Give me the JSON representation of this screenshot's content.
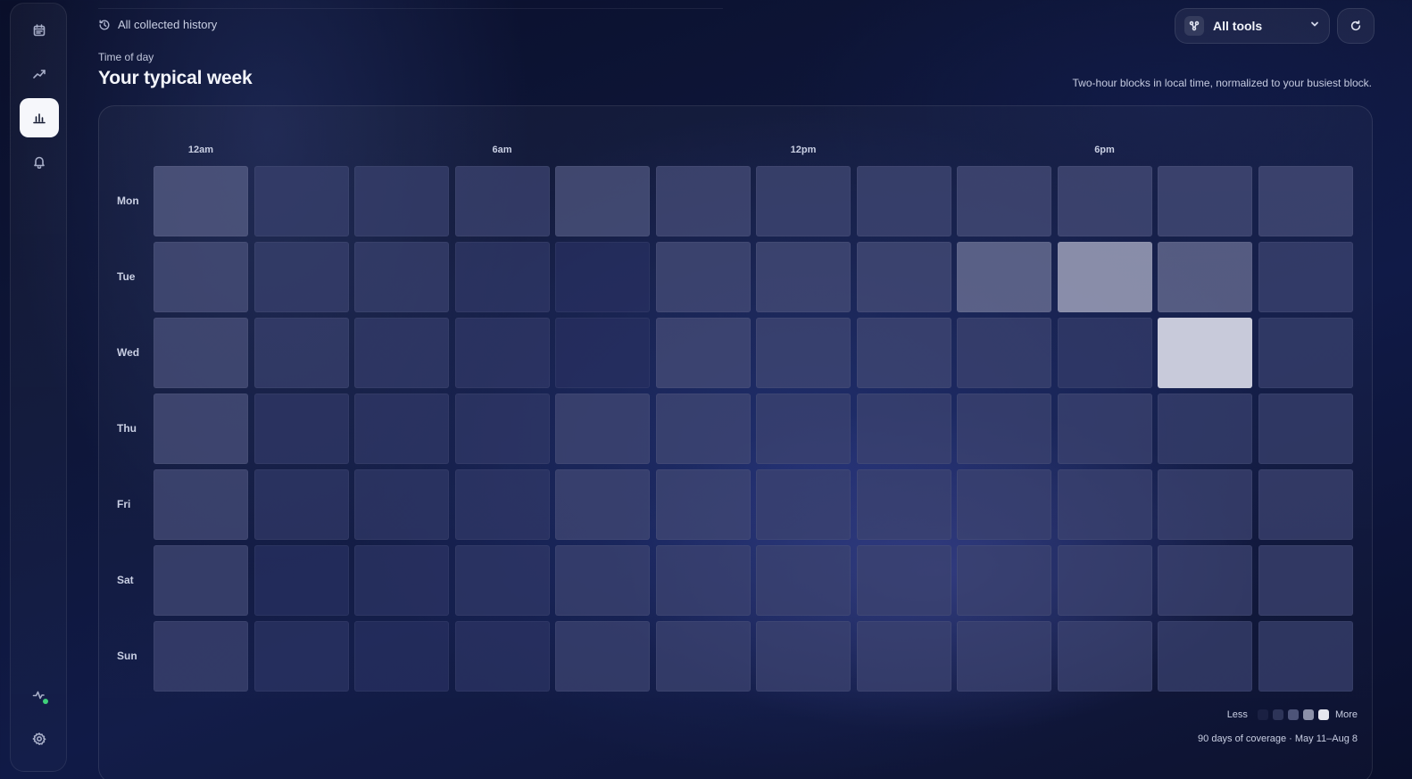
{
  "sidebar": {
    "items": [
      {
        "name": "calendar-icon",
        "active": false
      },
      {
        "name": "trend-icon",
        "active": false
      },
      {
        "name": "bar-chart-icon",
        "active": true
      },
      {
        "name": "bell-icon",
        "active": false
      }
    ],
    "bottom": [
      {
        "name": "activity-icon",
        "status": "online"
      },
      {
        "name": "gear-icon"
      }
    ]
  },
  "header": {
    "history_label": "All collected history",
    "eyebrow": "Time of day",
    "title": "Your typical week",
    "caption": "Two-hour blocks in local time, normalized to your busiest block.",
    "tools_label": "All tools"
  },
  "heatmap": {
    "hour_labels": [
      "12am",
      "6am",
      "12pm",
      "6pm"
    ],
    "days": [
      "Mon",
      "Tue",
      "Wed",
      "Thu",
      "Fri",
      "Sat",
      "Sun"
    ],
    "blocks_per_day": 12,
    "intensity": [
      [
        0.28,
        0.14,
        0.14,
        0.16,
        0.24,
        0.2,
        0.18,
        0.18,
        0.2,
        0.2,
        0.2,
        0.2
      ],
      [
        0.22,
        0.14,
        0.14,
        0.1,
        0.06,
        0.2,
        0.2,
        0.2,
        0.38,
        0.62,
        0.36,
        0.16
      ],
      [
        0.22,
        0.14,
        0.12,
        0.1,
        0.06,
        0.2,
        0.18,
        0.18,
        0.16,
        0.12,
        0.9,
        0.14
      ],
      [
        0.22,
        0.1,
        0.1,
        0.1,
        0.18,
        0.18,
        0.16,
        0.16,
        0.16,
        0.16,
        0.14,
        0.14
      ],
      [
        0.2,
        0.1,
        0.1,
        0.1,
        0.18,
        0.18,
        0.16,
        0.16,
        0.16,
        0.16,
        0.16,
        0.16
      ],
      [
        0.18,
        0.06,
        0.08,
        0.1,
        0.16,
        0.16,
        0.16,
        0.16,
        0.16,
        0.16,
        0.16,
        0.16
      ],
      [
        0.16,
        0.08,
        0.06,
        0.08,
        0.16,
        0.16,
        0.16,
        0.16,
        0.16,
        0.16,
        0.14,
        0.14
      ]
    ],
    "legend_less": "Less",
    "legend_more": "More",
    "coverage": "90 days of coverage · May 11–Aug 8"
  },
  "colors": {
    "cell_base": "#1c2558",
    "cell_peak": "#e2e3ee",
    "accent": "#3fd07a"
  }
}
